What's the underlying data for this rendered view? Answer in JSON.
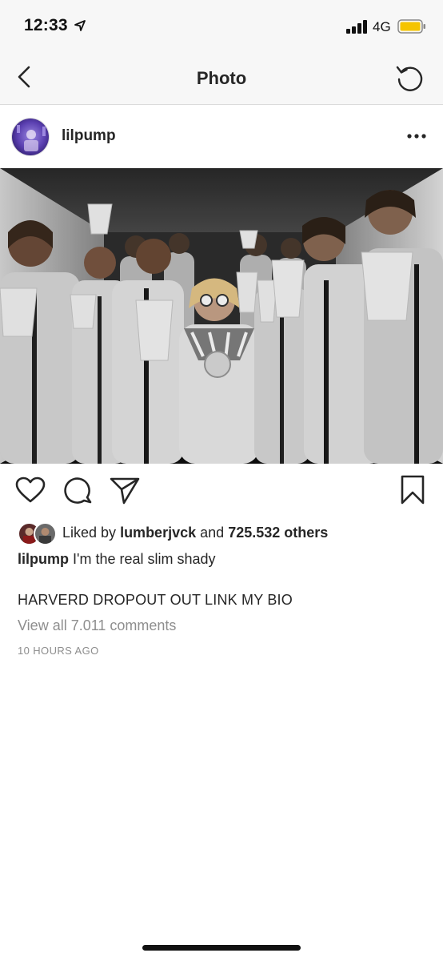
{
  "status_bar": {
    "time": "12:33",
    "network": "4G",
    "location_icon": "location-arrow-icon",
    "signal_icon": "signal-bars-icon",
    "battery_icon": "battery-icon",
    "battery_color": "#f5c400"
  },
  "nav": {
    "title": "Photo",
    "back_icon": "chevron-left-icon",
    "refresh_icon": "refresh-icon"
  },
  "post": {
    "username": "lilpump",
    "more_icon": "more-horizontal-icon",
    "photo_icon": "post-photo"
  },
  "actions": {
    "like_icon": "heart-icon",
    "comment_icon": "comment-icon",
    "share_icon": "send-icon",
    "save_icon": "bookmark-icon"
  },
  "likes": {
    "prefix": "Liked by",
    "user": "lumberjvck",
    "conjunction": "and",
    "count": "725.532 others"
  },
  "caption": {
    "user": "lilpump",
    "text": "I'm the real slim shady",
    "extra": "HARVERD DROPOUT OUT LINK MY BIO"
  },
  "comments": {
    "view_all": "View all 7.011 comments"
  },
  "timestamp": "10 HOURS AGO",
  "colors": {
    "text": "#262626",
    "secondary": "#8e8e8e",
    "bar_bg": "#f7f7f7",
    "divider": "#dbdbdb"
  }
}
